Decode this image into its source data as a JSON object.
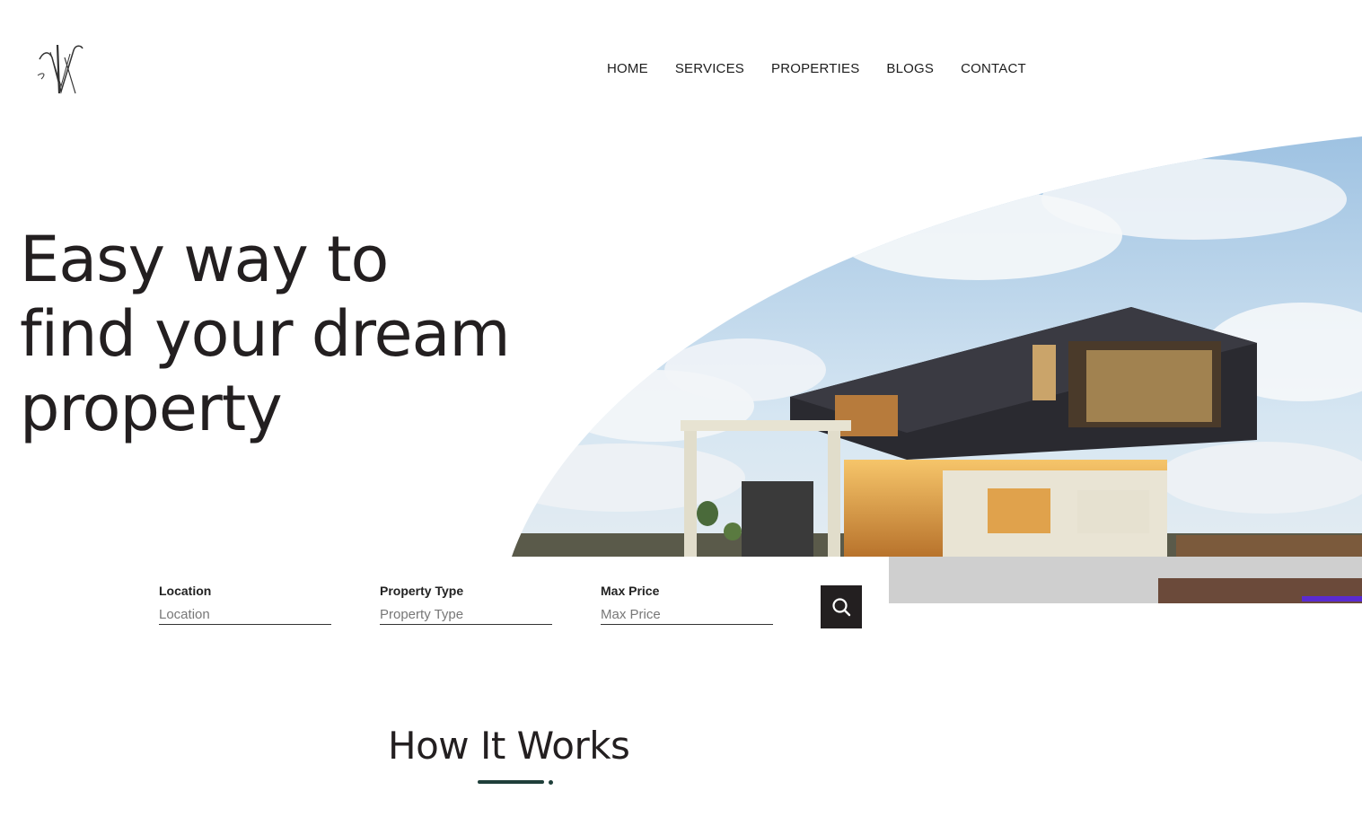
{
  "nav": {
    "items": [
      "HOME",
      "SERVICES",
      "PROPERTIES",
      "BLOGS",
      "CONTACT"
    ]
  },
  "hero": {
    "title_line1": "Easy way to",
    "title_line2": "find your dream",
    "title_line3": "property"
  },
  "search": {
    "location_label": "Location",
    "location_placeholder": "Location",
    "type_label": "Property Type",
    "type_placeholder": "Property Type",
    "price_label": "Max Price",
    "price_placeholder": "Max Price",
    "button_icon": "search-icon"
  },
  "section": {
    "title": "How It Works"
  },
  "colors": {
    "text": "#231f20",
    "accent": "#1f3f3a",
    "button_bg": "#231f20"
  }
}
